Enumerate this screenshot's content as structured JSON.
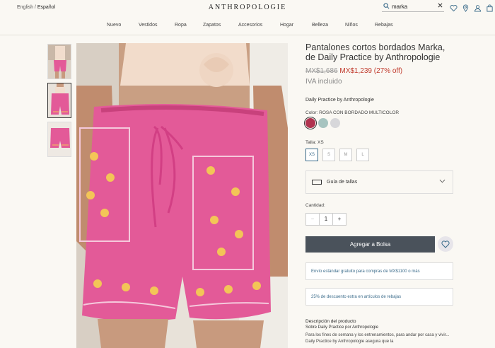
{
  "header": {
    "lang_en": "English",
    "lang_sep": "/",
    "lang_es": "Español",
    "brand": "ANTHROPOLOGIE",
    "search_value": "marka",
    "icons": [
      "heart-icon",
      "location-icon",
      "user-icon",
      "bag-icon"
    ]
  },
  "nav": [
    "Nuevo",
    "Vestidos",
    "Ropa",
    "Zapatos",
    "Accesorios",
    "Hogar",
    "Belleza",
    "Niños",
    "Rebajas"
  ],
  "product": {
    "title": "Pantalones cortos bordados Marka, de Daily Practice by Anthropologie",
    "price_original": "MX$1,686",
    "price_sale": "MX$1,239 (27% off)",
    "tax": "IVA incluido",
    "vendor": "Daily Practice by Anthropologie",
    "color_label": "Color: ROSA CON BORDADO MULTICOLOR",
    "swatches": [
      "#b0334f",
      "#a7c4c0",
      "#d7d7da"
    ],
    "size_label": "Talla: XS",
    "sizes": [
      "XS",
      "S",
      "M",
      "L"
    ],
    "size_guide": "Guía de tallas",
    "qty_label": "Cantidad:",
    "qty_minus": "−",
    "qty_value": "1",
    "qty_plus": "+",
    "add_to_bag": "Agregar a Bolsa",
    "promo_shipping": "Envío estándar gratuito para compras de MX$1100 o más",
    "promo_discount": "25% de descuento extra en artículos de rebajas",
    "description_heading": "Descripción del producto",
    "description_sub": "Sobre Daily Practice por Anthropologie",
    "description_body": "Para los fines de semana y los entrenamientos, para andar por casa y vivir... Daily Practice by Anthropologie asegura que la"
  },
  "colors": {
    "accent": "#3a6b8a",
    "button": "#4a525b",
    "sale": "#c0392b",
    "shorts": "#e35a98"
  }
}
